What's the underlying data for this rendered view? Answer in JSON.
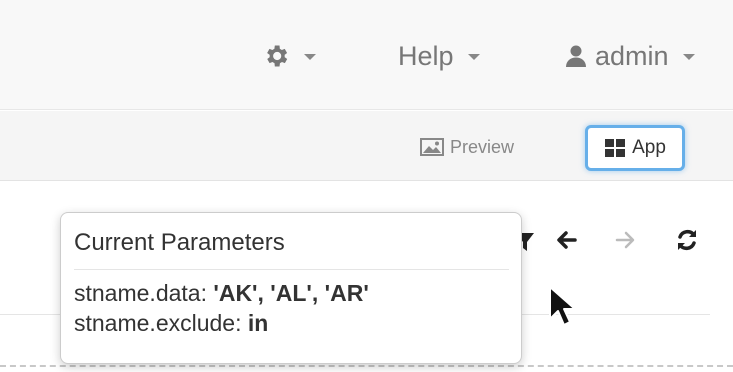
{
  "navbar": {
    "settings_icon": "gear-icon",
    "help_label": "Help",
    "user_icon": "user-icon",
    "user_label": "admin"
  },
  "toolbar": {
    "preview_icon": "image-icon",
    "preview_label": "Preview",
    "app_icon": "grid-icon",
    "app_label": "App",
    "accent_color": "#66afe9"
  },
  "actions": {
    "filter_icon": "filter-icon",
    "back_icon": "arrow-left-icon",
    "forward_icon": "arrow-right-icon",
    "refresh_icon": "refresh-icon"
  },
  "tooltip": {
    "title": "Current Parameters",
    "params": [
      {
        "key": "stname.data: ",
        "value": "'AK', 'AL', 'AR'"
      },
      {
        "key": "stname.exclude: ",
        "value": "in"
      }
    ]
  },
  "cursor": "arrow-cursor-icon"
}
